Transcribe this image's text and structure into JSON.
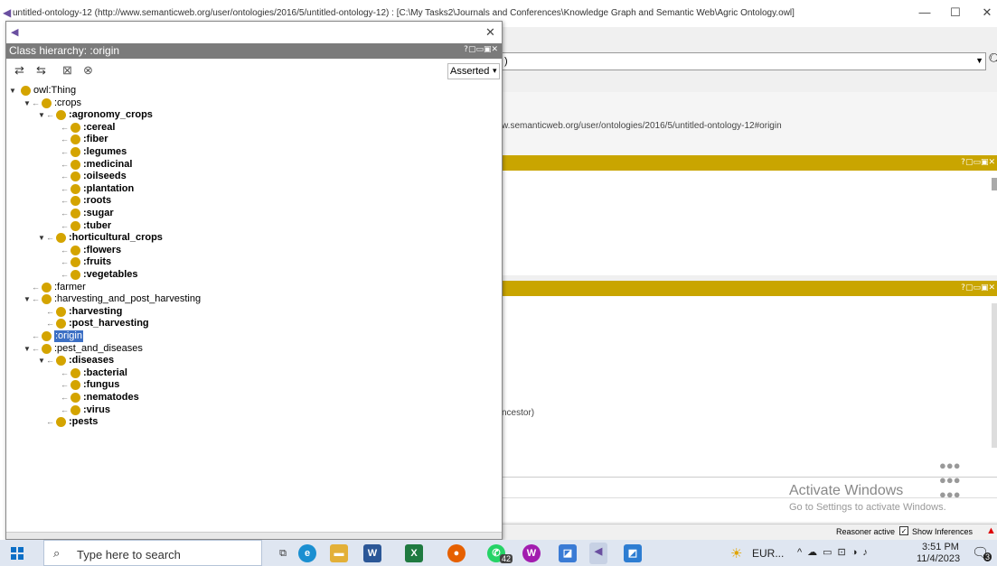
{
  "main_window": {
    "title": "untitled-ontology-12 (http://www.semanticweb.org/user/ontologies/2016/5/untitled-ontology-12) : [C:\\My Tasks2\\Journals and Conferences\\Knowledge Graph and Semantic Web\\Agric Ontology.owl]",
    "minimize": "—",
    "maximize": "☐",
    "close": "✕"
  },
  "background": {
    "search_value": ")",
    "iri_text": "w.semanticweb.org/user/ontologies/2016/5/untitled-ontology-12#origin",
    "ancestor_text": "ncestor)",
    "panel_buttons": "?▢▭▣✕",
    "watermark_title": "Activate Windows",
    "watermark_sub": "Go to Settings to activate Windows.",
    "reasoner_status": "Reasoner active",
    "show_inferences_label": "Show Inferences"
  },
  "float_window": {
    "close": "✕",
    "header_title": "Class hierarchy: :origin",
    "header_buttons": "?▢▭▣✕",
    "view_select_value": "Asserted",
    "view_select_arrow": "▾",
    "toolbar": {
      "add_subclass": "⇄",
      "add_sibling": "⇆",
      "delete": "⊠",
      "refresh": "⊗"
    }
  },
  "tree": [
    {
      "label": "owl:Thing",
      "depth": 0,
      "expanded": true,
      "bold": false
    },
    {
      "label": ":crops",
      "depth": 1,
      "expanded": true,
      "bold": false
    },
    {
      "label": ":agronomy_crops",
      "depth": 2,
      "expanded": true,
      "bold": true
    },
    {
      "label": ":cereal",
      "depth": 3,
      "bold": true
    },
    {
      "label": ":fiber",
      "depth": 3,
      "bold": true
    },
    {
      "label": ":legumes",
      "depth": 3,
      "bold": true
    },
    {
      "label": ":medicinal",
      "depth": 3,
      "bold": true
    },
    {
      "label": ":oilseeds",
      "depth": 3,
      "bold": true
    },
    {
      "label": ":plantation",
      "depth": 3,
      "bold": true
    },
    {
      "label": ":roots",
      "depth": 3,
      "bold": true
    },
    {
      "label": ":sugar",
      "depth": 3,
      "bold": true
    },
    {
      "label": ":tuber",
      "depth": 3,
      "bold": true
    },
    {
      "label": ":horticultural_crops",
      "depth": 2,
      "expanded": true,
      "bold": true
    },
    {
      "label": ":flowers",
      "depth": 3,
      "bold": true
    },
    {
      "label": ":fruits",
      "depth": 3,
      "bold": true
    },
    {
      "label": ":vegetables",
      "depth": 3,
      "bold": true
    },
    {
      "label": ":farmer",
      "depth": 1,
      "bold": false
    },
    {
      "label": ":harvesting_and_post_harvesting",
      "depth": 1,
      "expanded": true,
      "bold": false
    },
    {
      "label": ":harvesting",
      "depth": 2,
      "bold": true
    },
    {
      "label": ":post_harvesting",
      "depth": 2,
      "bold": true
    },
    {
      "label": ":origin",
      "depth": 1,
      "bold": false,
      "selected": true
    },
    {
      "label": ":pest_and_diseases",
      "depth": 1,
      "expanded": true,
      "bold": false
    },
    {
      "label": ":diseases",
      "depth": 2,
      "expanded": true,
      "bold": true
    },
    {
      "label": ":bacterial",
      "depth": 3,
      "bold": true
    },
    {
      "label": ":fungus",
      "depth": 3,
      "bold": true
    },
    {
      "label": ":nematodes",
      "depth": 3,
      "bold": true
    },
    {
      "label": ":virus",
      "depth": 3,
      "bold": true
    },
    {
      "label": ":pests",
      "depth": 2,
      "bold": true
    }
  ],
  "taskbar": {
    "search_placeholder": "Type here to search",
    "whatsapp_badge": "42",
    "eur_label": "EUR...",
    "time": "3:51 PM",
    "date": "11/4/2023",
    "notification_count": "3"
  }
}
